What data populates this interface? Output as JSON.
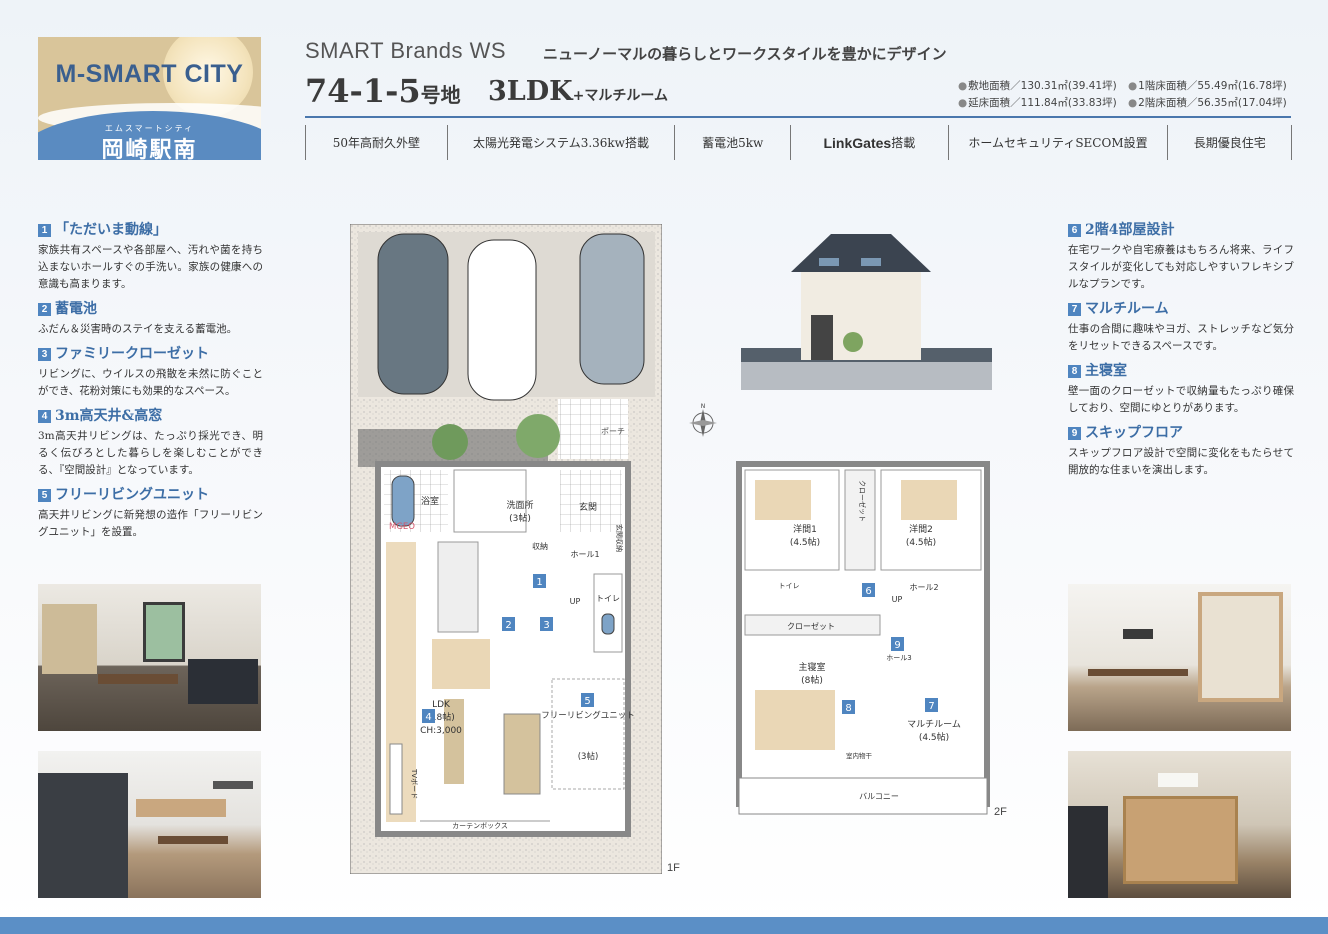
{
  "logo": {
    "name": "M-SMART CITY",
    "kana": "エムスマートシティ",
    "place": "岡崎駅南"
  },
  "header": {
    "brand": "SMART Brands WS",
    "tagline": "ニューノーマルの暮らしとワークスタイルを豊かにデザイン",
    "lot_number": "74-1-5",
    "lot_suffix": "号地",
    "plan": "3LDK",
    "plan_suffix": "+マルチルーム"
  },
  "areas": {
    "site": "敷地面積／130.31㎡(39.41坪)",
    "floor1": "1階床面積／55.49㎡(16.78坪)",
    "total": "延床面積／111.84㎡(33.83坪)",
    "floor2": "2階床面積／56.35㎡(17.04坪)"
  },
  "features": {
    "f1": "50年高耐久外壁",
    "f2": "太陽光発電システム3.36kw搭載",
    "f3": "蓄電池5kw",
    "f4_logo": "LinkGates",
    "f4_suffix": "搭載",
    "f5": "ホームセキュリティSECOM設置",
    "f6": "長期優良住宅"
  },
  "left_sections": [
    {
      "num": "1",
      "title": "「ただいま動線」",
      "body": "家族共有スペースや各部屋へ、汚れや菌を持ち込まないホールすぐの手洗い。家族の健康への意識も高まります。"
    },
    {
      "num": "2",
      "title": "蓄電池",
      "body": "ふだん＆災害時のステイを支える蓄電池。"
    },
    {
      "num": "3",
      "title": "ファミリークローゼット",
      "body": "リビングに、ウイルスの飛散を未然に防ぐことができ、花粉対策にも効果的なスペース。"
    },
    {
      "num": "4",
      "title": "3m高天井&高窓",
      "body": "3m高天井リビングは、たっぷり採光でき、明るく伝びろとした暮らしを楽しむことができる、『空間設計』となっています。"
    },
    {
      "num": "5",
      "title": "フリーリビングユニット",
      "body": "高天井リビングに新発想の造作「フリーリビングユニット」を設置。"
    }
  ],
  "right_sections": [
    {
      "num": "6",
      "title": "2階4部屋設計",
      "body": "在宅ワークや自宅療養はもちろん将来、ライフスタイルが変化しても対応しやすいフレキシブルなプランです。"
    },
    {
      "num": "7",
      "title": "マルチルーム",
      "body": "仕事の合間に趣味やヨガ、ストレッチなど気分をリセットできるスペースです。"
    },
    {
      "num": "8",
      "title": "主寝室",
      "body": "壁一面のクローゼットで収納量もたっぷり確保しており、空間にゆとりがあります。"
    },
    {
      "num": "9",
      "title": "スキップフロア",
      "body": "スキップフロア設計で空間に変化をもたらせて開放的な住まいを演出します。"
    }
  ],
  "plan1": {
    "floor": "1F",
    "porch": "ポーチ",
    "bath": "浴室",
    "washroom": "洗面所",
    "washroom_size": "(3帖)",
    "entrance": "玄関",
    "storage_entrance": "玄関収納",
    "storage": "収納",
    "hall": "ホール1",
    "toilet": "トイレ",
    "up": "UP",
    "mgeo": "MGEO",
    "ldk": "LDK",
    "ldk_size": "(18帖)",
    "ldk_ch": "CH:3,000",
    "free_living": "フリーリビングユニット",
    "free_living_size": "(3帖)",
    "tv_board": "TVボード",
    "curtain_box": "カーテンボックス",
    "markers": [
      "1",
      "2",
      "3",
      "4",
      "5"
    ]
  },
  "plan2": {
    "floor": "2F",
    "closet": "クローゼット",
    "room1": "洋間1",
    "room1_size": "(4.5帖)",
    "room2": "洋間2",
    "room2_size": "(4.5帖)",
    "toilet": "トイレ",
    "hall2": "ホール2",
    "hall3": "ホール3",
    "up": "UP",
    "master": "主寝室",
    "master_size": "(8帖)",
    "multi": "マルチルーム",
    "multi_size": "(4.5帖)",
    "drying": "室内物干",
    "balcony": "バルコニー",
    "markers": [
      "6",
      "7",
      "8",
      "9"
    ]
  },
  "colors": {
    "accent": "#3d6ea6",
    "marker": "#4f85c0",
    "band": "#5b8fc6",
    "mgeo": "#d4546a"
  }
}
